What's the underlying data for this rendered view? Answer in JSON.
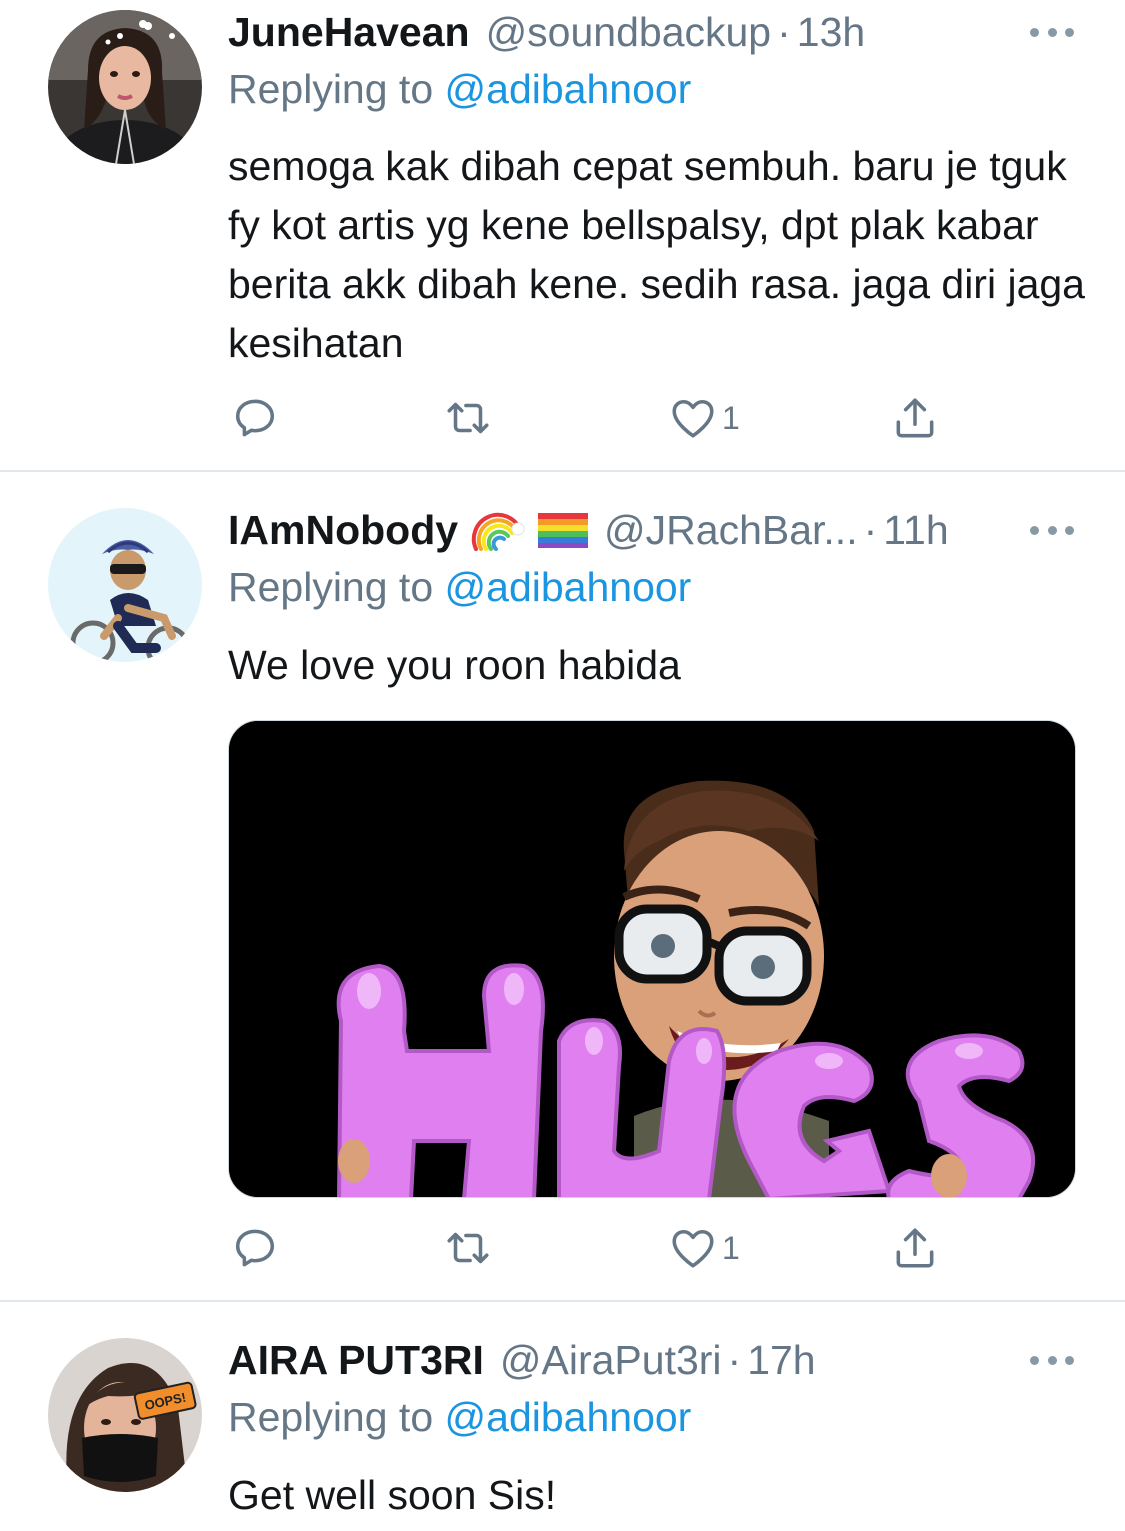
{
  "tweets": [
    {
      "name": "JuneHavean",
      "handle": "@soundbackup",
      "separator": "·",
      "time": "13h",
      "replying_prefix": "Replying to",
      "replying_to": "@adibahnoor",
      "text": "semoga kak dibah cepat sembuh. baru je tguk fy kot artis yg kene bellspalsy, dpt plak kabar berita akk dibah kene. sedih rasa. jaga diri jaga kesihatan",
      "likes": "1",
      "avatar_icon": "person-selfie-avatar"
    },
    {
      "name": "IAmNobody",
      "emojis": [
        "rainbow-icon",
        "rainbow-flag-icon"
      ],
      "handle": "@JRachBar...",
      "separator": "·",
      "time": "11h",
      "replying_prefix": "Replying to",
      "replying_to": "@adibahnoor",
      "text": "We love you roon habida",
      "media_text": "HUGS",
      "likes": "1",
      "avatar_icon": "cyclist-emoji-avatar"
    },
    {
      "name": "AIRA PUT3RI",
      "handle": "@AiraPut3ri",
      "separator": "·",
      "time": "17h",
      "replying_prefix": "Replying to",
      "replying_to": "@adibahnoor",
      "text": "Get well soon Sis!",
      "avatar_badge": "OOPS!",
      "avatar_icon": "masked-person-avatar"
    }
  ],
  "colors": {
    "link": "#1b95e0",
    "secondary_text": "#657786",
    "divider": "#e1e8ed",
    "icon": "#657786",
    "media_bg": "#000000",
    "hugs_purple": "#e07ff0"
  }
}
